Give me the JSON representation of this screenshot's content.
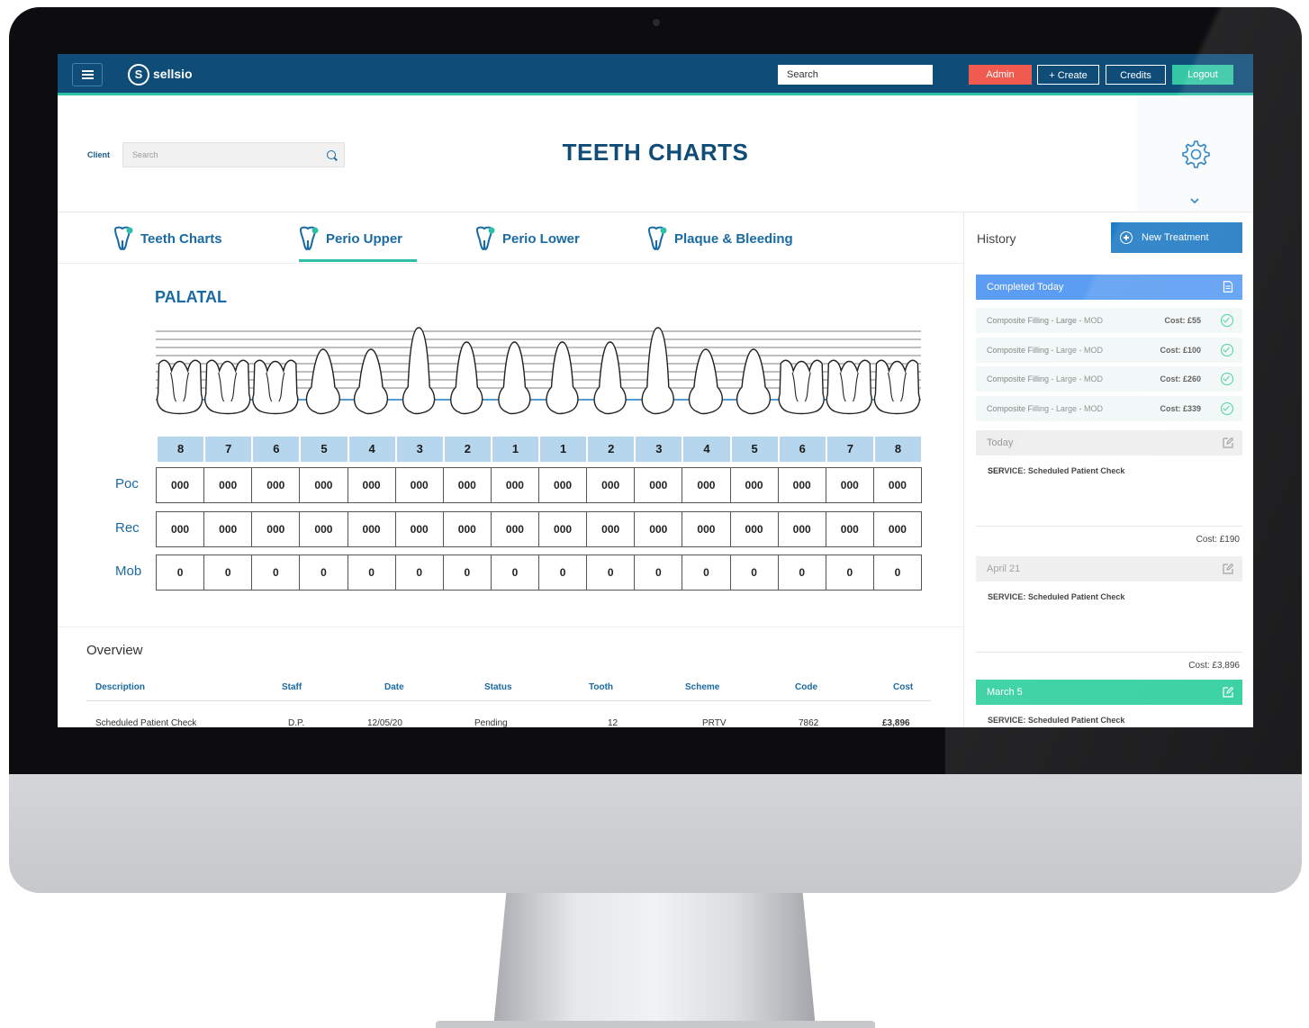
{
  "topbar": {
    "brand": "sellsio",
    "brand_initial": "S",
    "search_value": "Search",
    "admin": "Admin",
    "create": "+ Create",
    "credits": "Credits",
    "logout": "Logout"
  },
  "header": {
    "client_label": "Client",
    "client_search_placeholder": "Search",
    "title": "TEETH CHARTS"
  },
  "tabs": [
    {
      "label": "Teeth Charts"
    },
    {
      "label": "Perio Upper"
    },
    {
      "label": "Perio Lower"
    },
    {
      "label": "Plaque & Bleeding"
    }
  ],
  "active_tab": "Perio Upper",
  "chart": {
    "surface": "PALATAL",
    "tooth_numbers": [
      "8",
      "7",
      "6",
      "5",
      "4",
      "3",
      "2",
      "1",
      "1",
      "2",
      "3",
      "4",
      "5",
      "6",
      "7",
      "8"
    ],
    "rows": [
      {
        "label": "Poc",
        "values": [
          "000",
          "000",
          "000",
          "000",
          "000",
          "000",
          "000",
          "000",
          "000",
          "000",
          "000",
          "000",
          "000",
          "000",
          "000",
          "000"
        ]
      },
      {
        "label": "Rec",
        "values": [
          "000",
          "000",
          "000",
          "000",
          "000",
          "000",
          "000",
          "000",
          "000",
          "000",
          "000",
          "000",
          "000",
          "000",
          "000",
          "000"
        ]
      },
      {
        "label": "Mob",
        "values": [
          "0",
          "0",
          "0",
          "0",
          "0",
          "0",
          "0",
          "0",
          "0",
          "0",
          "0",
          "0",
          "0",
          "0",
          "0",
          "0"
        ]
      }
    ]
  },
  "overview": {
    "title": "Overview",
    "columns": [
      "Description",
      "Staff",
      "Date",
      "Status",
      "Tooth",
      "Scheme",
      "Code",
      "Cost"
    ],
    "rows": [
      [
        "Scheduled Patient Check",
        "D.P.",
        "12/05/20",
        "Pending",
        "12",
        "PRTV",
        "7862",
        "£3,896"
      ]
    ]
  },
  "history": {
    "title": "History",
    "new_treatment": "New Treatment",
    "completed_label": "Completed Today",
    "treatments": [
      {
        "name": "Composite Filling - Large - MOD",
        "cost": "Cost: £55"
      },
      {
        "name": "Composite Filling - Large - MOD",
        "cost": "Cost: £100"
      },
      {
        "name": "Composite Filling - Large - MOD",
        "cost": "Cost: £260"
      },
      {
        "name": "Composite Filling - Large - MOD",
        "cost": "Cost: £339"
      }
    ],
    "entries": [
      {
        "date": "Today",
        "service": "SERVICE: Scheduled Patient Check",
        "cost": "Cost: £190"
      },
      {
        "date": "April 21",
        "service": "SERVICE: Scheduled Patient Check",
        "cost": "Cost: £3,896"
      },
      {
        "date": "March 5",
        "service": "SERVICE: Scheduled Patient Check",
        "cost": ""
      }
    ]
  },
  "colors": {
    "navbar": "#0f4d78",
    "accent": "#2ec0a6",
    "primary_text": "#1a6aa3",
    "admin_button": "#f05a4f",
    "logout_button": "#35c7a5",
    "completed_bar": "#5b9df2",
    "march_bar": "#2fcf9d"
  }
}
